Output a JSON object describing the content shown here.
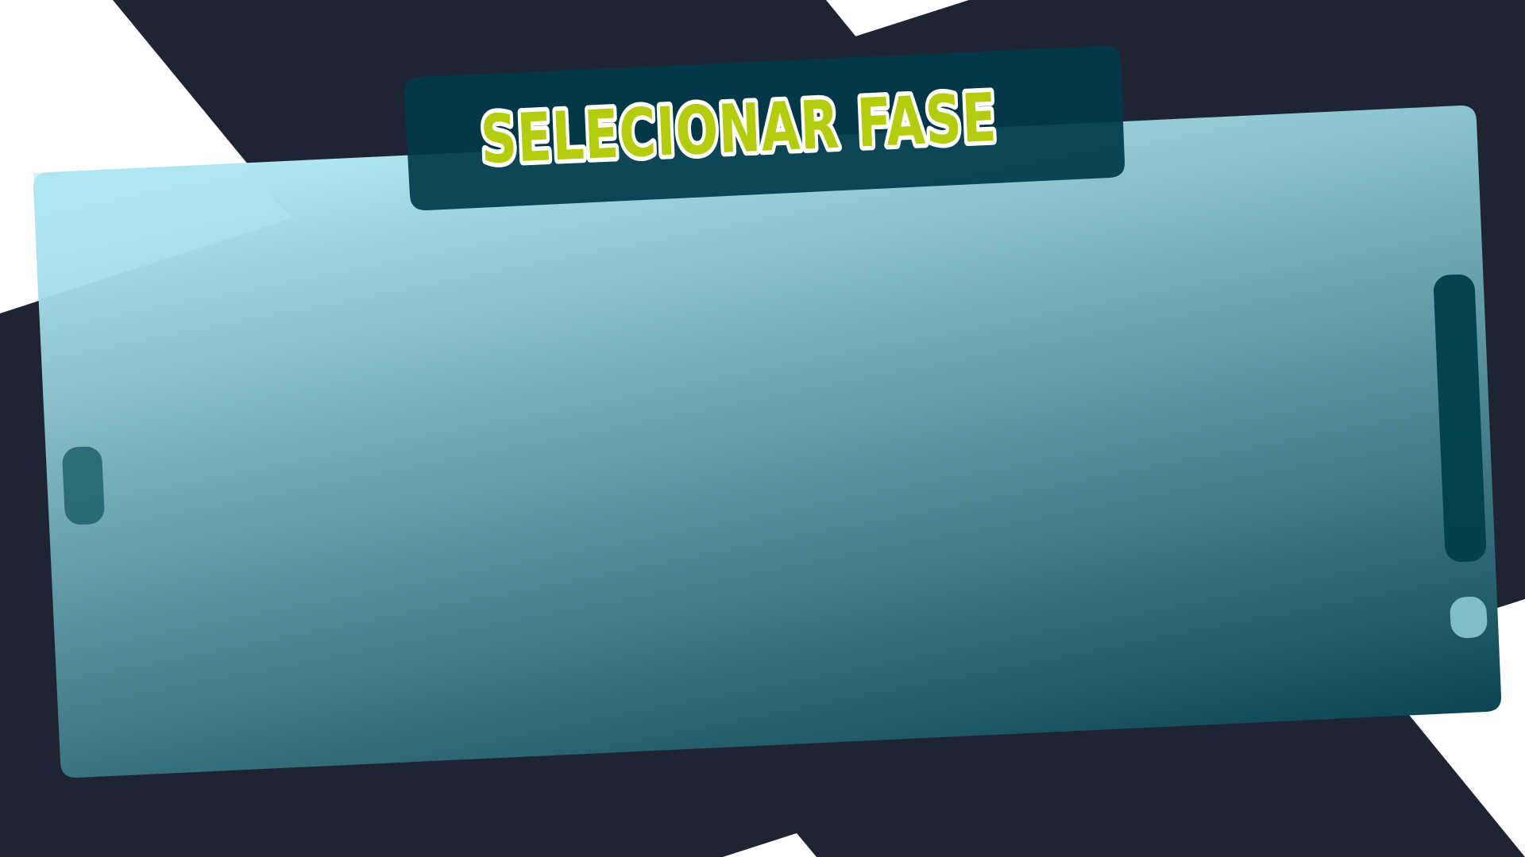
{
  "screen": {
    "title": "SELECIONAR FASE"
  },
  "colors": {
    "background_dark": "#1f2433",
    "background_light": "#ffffff",
    "panel_gradient_top": "#b0e6f2",
    "panel_gradient_bottom": "#033a49",
    "title_bar": "#003a4a",
    "title_fill": "#b5cc0c",
    "title_outline": "#ffffff",
    "scrollbar_track": "#003e4e",
    "scroll_indicator": "#8cc8d4",
    "left_arrow_handle": "#1f5f6e"
  },
  "controls": {
    "left_handle_icon": "previous-handle-icon",
    "scrollbar_icon": "scrollbar-track",
    "scroll_thumb_icon": "scroll-thumb-icon"
  }
}
